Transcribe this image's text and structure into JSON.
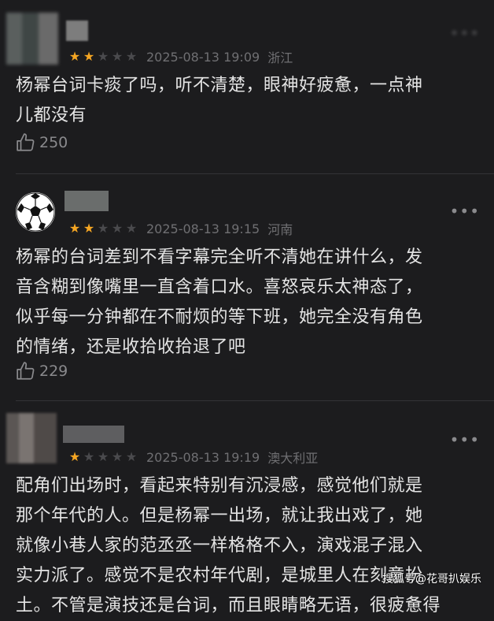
{
  "comments": [
    {
      "stars_on": 2,
      "stars_total": 5,
      "date": "2025-08-13 19:09",
      "location": "浙江",
      "lines": [
        "杨幂台词卡痰了吗，听不清楚，眼神好疲惫，一点神",
        "儿都没有"
      ],
      "likes": "250",
      "avatar_icon": "blurred-avatar"
    },
    {
      "stars_on": 2,
      "stars_total": 5,
      "date": "2025-08-13 19:15",
      "location": "河南",
      "lines": [
        "杨幂的台词差到不看字幕完全听不清她在讲什么，发",
        "音含糊到像嘴里一直含着口水。喜怒哀乐太神态了，",
        "似乎每一分钟都在不耐烦的等下班，她完全没有角色",
        "的情绪，还是收拾收拾退了吧"
      ],
      "likes": "229",
      "avatar_icon": "soccer-ball-avatar"
    },
    {
      "stars_on": 1,
      "stars_total": 5,
      "date": "2025-08-13 19:19",
      "location": "澳大利亚",
      "lines": [
        "配角们出场时，看起来特别有沉浸感，感觉他们就是",
        "那个年代的人。但是杨幂一出场，就让我出戏了，她",
        "就像小巷人家的范丞丞一样格格不入，演戏混子混入",
        "实力派了。感觉不是农村年代剧，是城里人在刻意扮",
        "土。不管是演技还是台词，而且眼睛略无语，很疲惫得"
      ],
      "avatar_icon": "blurred-avatar"
    }
  ],
  "more_label": "•••",
  "watermark": "搜狐号@花哥扒娱乐",
  "colors": {
    "background": "#1c1c1e",
    "star_on": "#f5a623",
    "star_off": "#4a4a4d",
    "text": "#e4e4e4",
    "meta": "#6f6f72"
  }
}
